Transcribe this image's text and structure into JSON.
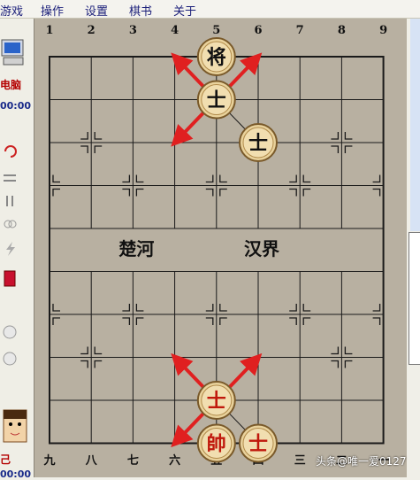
{
  "menu": [
    {
      "label": "游戏"
    },
    {
      "label": "操作"
    },
    {
      "label": "设置"
    },
    {
      "label": "棋书"
    },
    {
      "label": "关于"
    }
  ],
  "left_panel": {
    "top_player_label": "电脑",
    "top_timer": "00:00",
    "bottom_player_label": "己",
    "bottom_timer": "00:00"
  },
  "board": {
    "top_files": [
      "1",
      "2",
      "3",
      "4",
      "5",
      "6",
      "7",
      "8",
      "9"
    ],
    "bottom_files": [
      "九",
      "八",
      "七",
      "六",
      "五",
      "四",
      "三",
      "二",
      "一"
    ],
    "river_left": "楚河",
    "river_right": "汉界"
  },
  "pieces": [
    {
      "name": "black-general",
      "label": "将",
      "side": "black",
      "file": 5,
      "rank": 1
    },
    {
      "name": "black-advisor-1",
      "label": "士",
      "side": "black",
      "file": 5,
      "rank": 2
    },
    {
      "name": "black-advisor-2",
      "label": "士",
      "side": "black",
      "file": 6,
      "rank": 3
    },
    {
      "name": "red-advisor-1",
      "label": "士",
      "side": "red",
      "file": 5,
      "rank": 9
    },
    {
      "name": "red-general",
      "label": "帥",
      "side": "red",
      "file": 5,
      "rank": 10
    },
    {
      "name": "red-advisor-2",
      "label": "士",
      "side": "red",
      "file": 6,
      "rank": 10
    }
  ],
  "arrows_color": "#e02020",
  "watermark": "头条@唯一爱0127"
}
